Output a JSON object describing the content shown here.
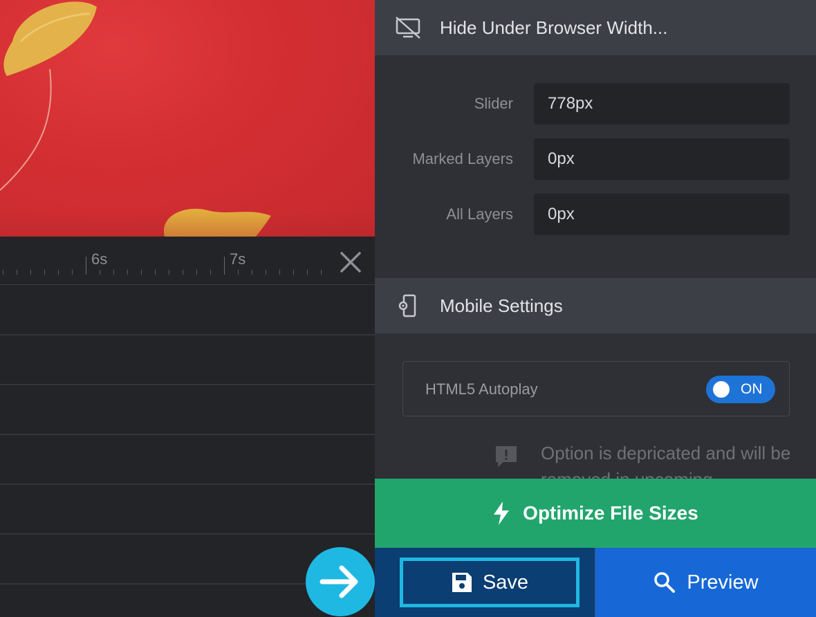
{
  "timeline": {
    "ruler_labels": [
      "6s",
      "7s"
    ]
  },
  "panel": {
    "hide_section": {
      "title": "Hide Under Browser Width...",
      "icon": "hidden-monitor-icon",
      "rows": [
        {
          "label": "Slider",
          "value": "778px"
        },
        {
          "label": "Marked Layers",
          "value": "0px"
        },
        {
          "label": "All Layers",
          "value": "0px"
        }
      ]
    },
    "mobile_section": {
      "title": "Mobile Settings",
      "icon": "mobile-settings-icon",
      "autoplay_label": "HTML5 Autoplay",
      "autoplay_state": "ON",
      "notice": "Option is depricated and will be removed in upcoming"
    }
  },
  "actions": {
    "optimize_label": "Optimize File Sizes",
    "save_label": "Save",
    "preview_label": "Preview"
  },
  "colors": {
    "optimize": "#21a56d",
    "save": "#0b3e72",
    "preview": "#1768d6",
    "highlight": "#1fb8e2",
    "canvas_bg": "#d42f33"
  }
}
